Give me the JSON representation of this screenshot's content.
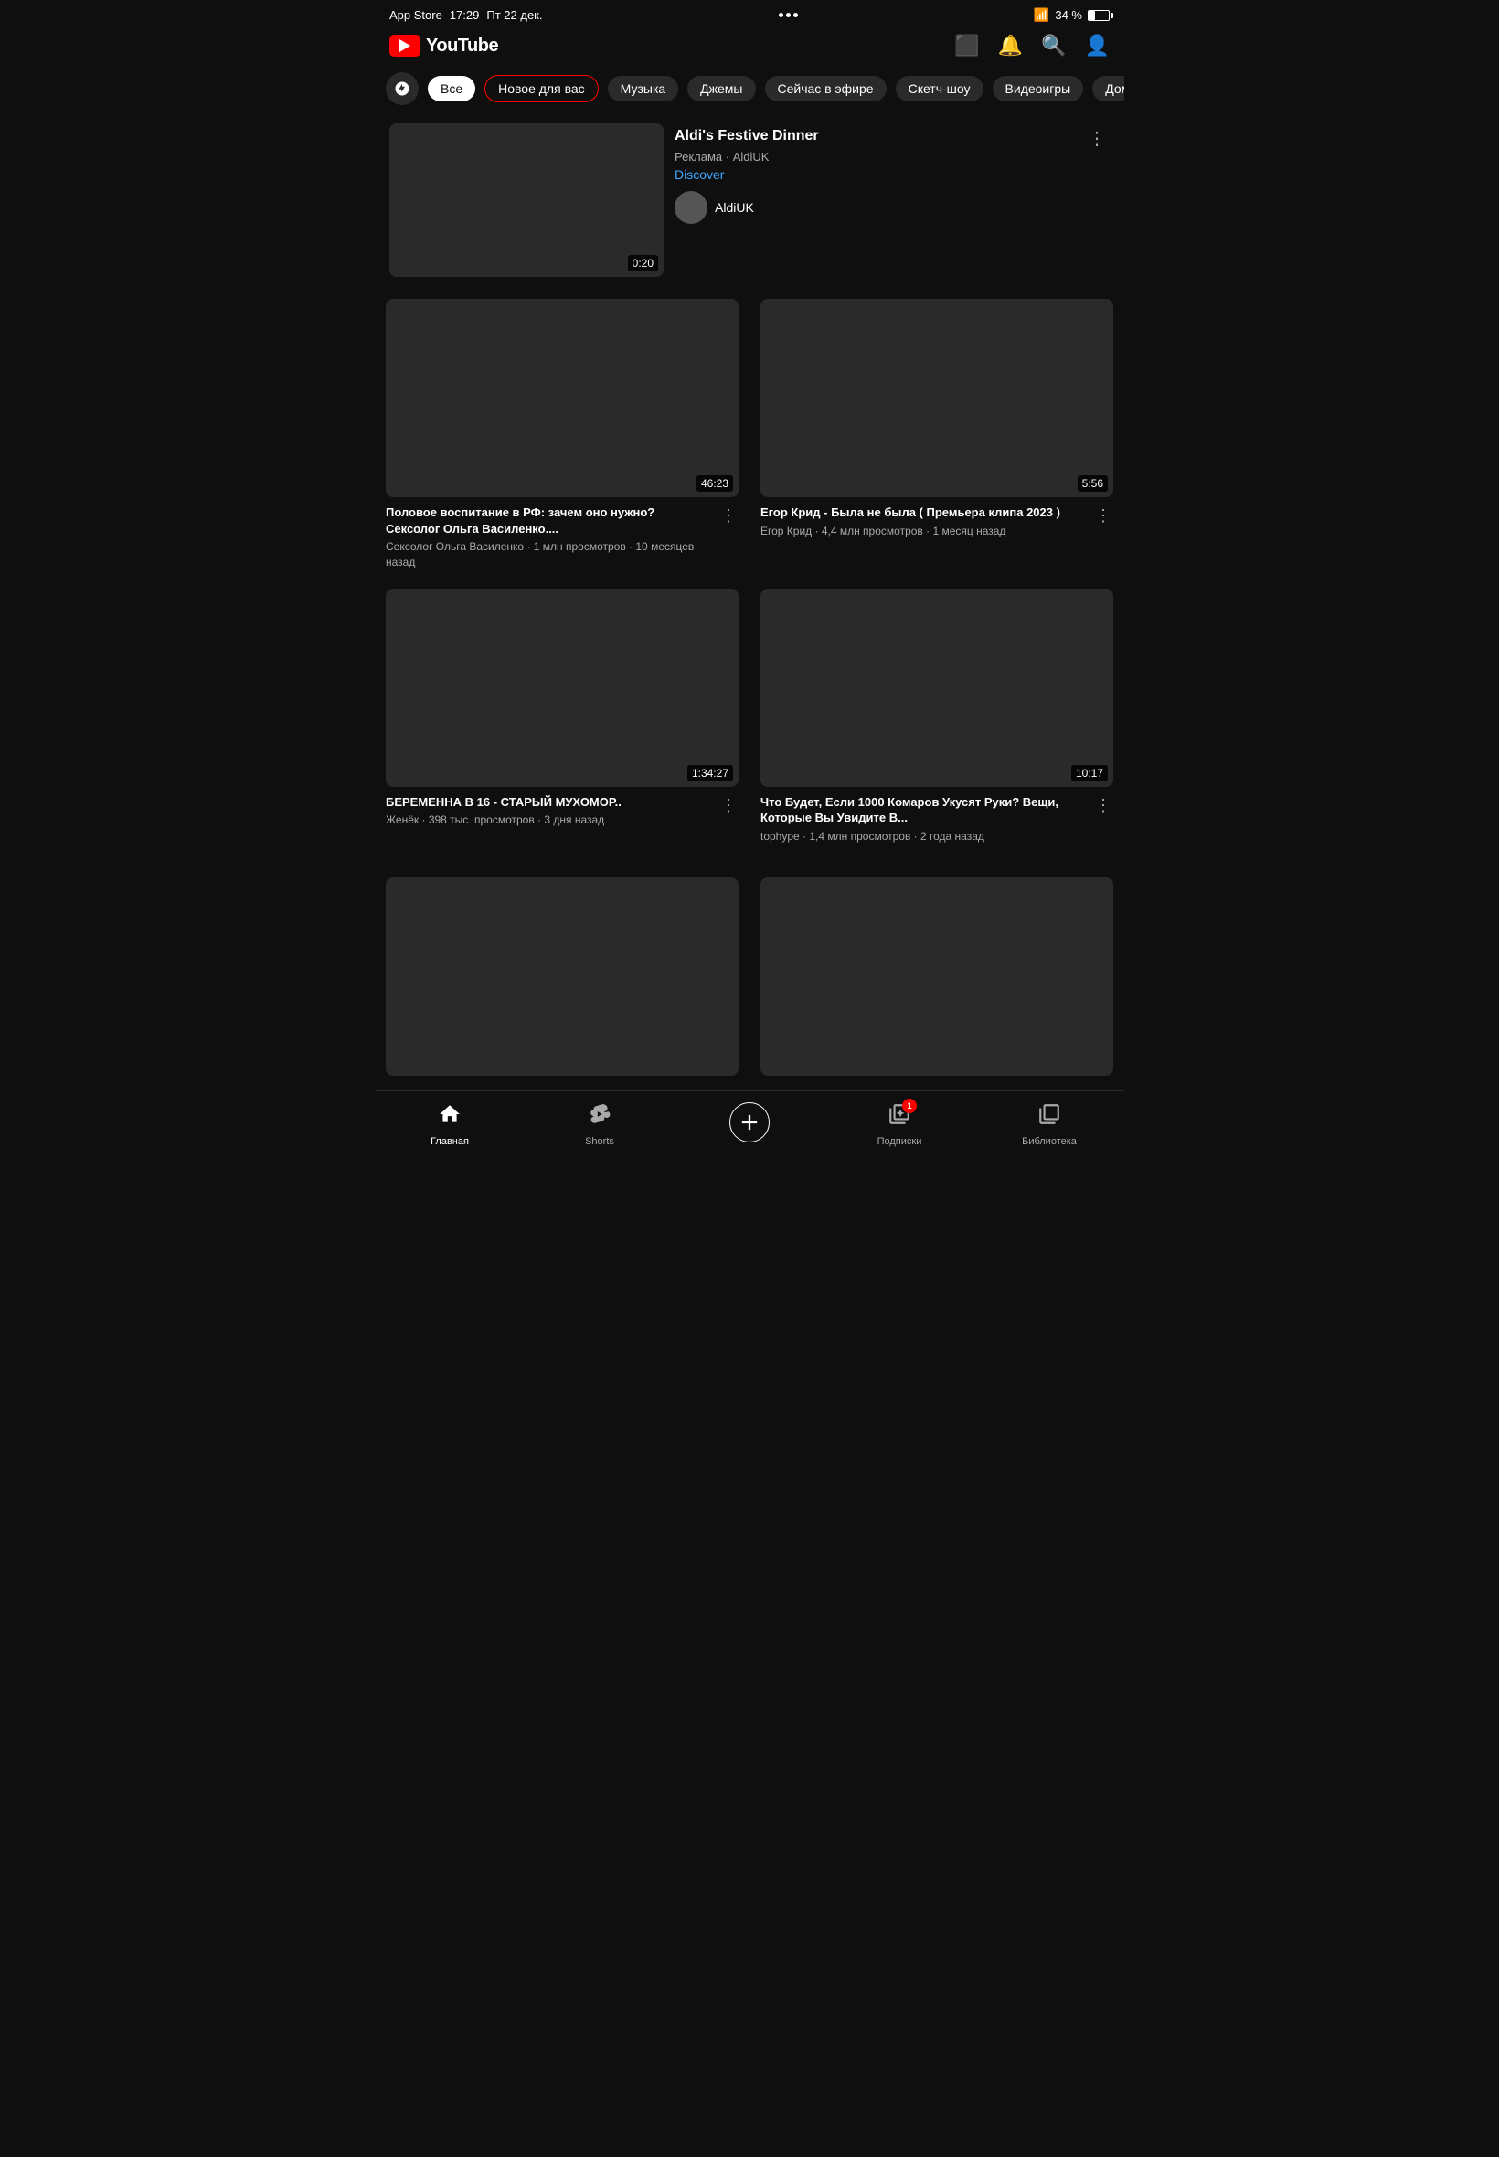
{
  "statusBar": {
    "carrier": "App Store",
    "time": "17:29",
    "date": "Пт 22 дек.",
    "battery": "34 %"
  },
  "header": {
    "logoText": "YouTube"
  },
  "categories": [
    {
      "id": "explore",
      "type": "icon"
    },
    {
      "id": "all",
      "label": "Все",
      "active": true
    },
    {
      "id": "new-for-you",
      "label": "Новое для вас",
      "outline": true
    },
    {
      "id": "music",
      "label": "Музыка"
    },
    {
      "id": "games",
      "label": "Джемы"
    },
    {
      "id": "live",
      "label": "Сейчас в эфире"
    },
    {
      "id": "sketch",
      "label": "Скетч-шоу"
    },
    {
      "id": "videogames",
      "label": "Видеоигры"
    },
    {
      "id": "home",
      "label": "Дома"
    }
  ],
  "ad": {
    "title": "Aldi's Festive Dinner",
    "adLabel": "Реклама · AldiUK",
    "discoverText": "Discover",
    "channelName": "AldiUK",
    "duration": "0:20"
  },
  "videos": [
    {
      "id": "v1",
      "title": "Половое воспитание в РФ: зачем оно нужно? Сексолог Ольга Василенко....",
      "channel": "Сексолог Ольга Василенко",
      "views": "1 млн просмотров",
      "time": "10 месяцев назад",
      "duration": "46:23"
    },
    {
      "id": "v2",
      "title": "Егор Крид - Была не была ( Премьера клипа 2023 )",
      "channel": "Егор Крид",
      "views": "4,4 млн просмотров",
      "time": "1 месяц назад",
      "duration": "5:56"
    },
    {
      "id": "v3",
      "title": "БЕРЕМЕННА В 16 - СТАРЫЙ МУХОМОР..",
      "channel": "Женёк",
      "views": "398 тыс. просмотров",
      "time": "3 дня назад",
      "duration": "1:34:27"
    },
    {
      "id": "v4",
      "title": "Что Будет, Если 1000 Комаров Укусят Руки? Вещи, Которые Вы Увидите В...",
      "channel": "tophype",
      "views": "1,4 млн просмотров",
      "time": "2 года назад",
      "duration": "10:17"
    }
  ],
  "bottomNav": [
    {
      "id": "home",
      "icon": "⌂",
      "label": "Главная",
      "active": true
    },
    {
      "id": "shorts",
      "icon": "shorts",
      "label": "Shorts",
      "active": false
    },
    {
      "id": "add",
      "icon": "+",
      "label": "",
      "active": false,
      "special": true
    },
    {
      "id": "subscriptions",
      "icon": "subscriptions",
      "label": "Подписки",
      "badge": "1",
      "active": false
    },
    {
      "id": "library",
      "icon": "library",
      "label": "Библиотека",
      "active": false
    }
  ]
}
